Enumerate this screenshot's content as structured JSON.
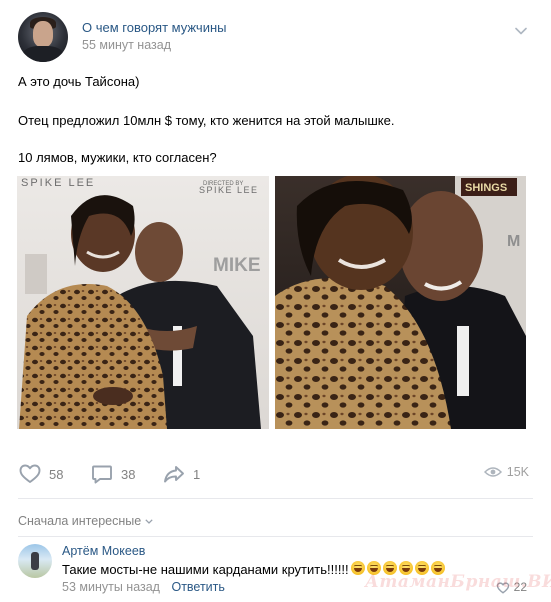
{
  "post": {
    "group_name": "О чем говорят мужчины",
    "time": "55 минут назад",
    "text_lines": [
      "А это дочь Тайсона)",
      "Отец предложил 10млн $ тому, кто женится на этой малышке.",
      "10 лямов, мужики, кто согласен?"
    ],
    "photo1_caption_top": "SPIKE LEE",
    "photo1_directed": "DIRECTED BY",
    "photo1_directed_name": "SPIKE LEE",
    "photo1_title": "MIKE",
    "photo2_sign": "SHINGS",
    "photo2_title": "M"
  },
  "actions": {
    "likes": "58",
    "comments": "38",
    "shares": "1",
    "views": "15K"
  },
  "comments": {
    "sort_label": "Сначала интересные",
    "items": [
      {
        "author": "Артём Мокеев",
        "text": "Такие мосты-не нашими карданами крутить!!!!!!",
        "emoji_count": 6,
        "time": "53 минуты назад",
        "reply_label": "Ответить",
        "likes": "22"
      }
    ]
  },
  "watermark": "АтаманБрнаш.ВИТЕ",
  "colors": {
    "link": "#2a5885",
    "meta": "#939393",
    "icon": "#99a2ad"
  }
}
